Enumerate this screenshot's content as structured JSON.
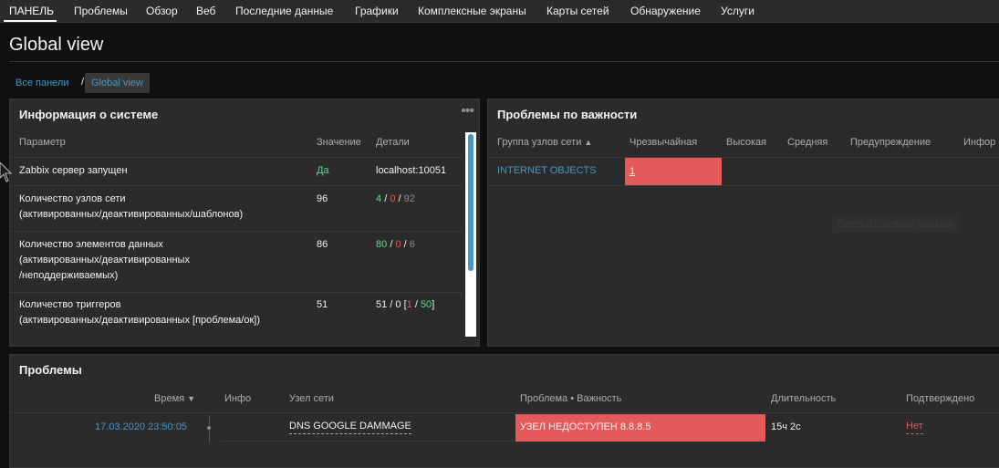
{
  "nav": {
    "items": [
      "ПАНЕЛЬ",
      "Проблемы",
      "Обзор",
      "Веб",
      "Последние данные",
      "Графики",
      "Комплексные экраны",
      "Карты сетей",
      "Обнаружение",
      "Услуги"
    ]
  },
  "page": {
    "title": "Global view"
  },
  "breadcrumb": {
    "all": "Все панели",
    "sep": "/",
    "current": "Global view"
  },
  "sysinfo": {
    "title": "Информация о системе",
    "headers": {
      "param": "Параметр",
      "value": "Значение",
      "details": "Детали"
    },
    "rows": [
      {
        "param": [
          "Zabbix сервер запущен"
        ],
        "value": "Да",
        "details": "localhost:10051"
      },
      {
        "param": [
          "Количество узлов сети",
          "(активированных/деактивированных/шаблонов)"
        ],
        "value": "96",
        "d1": "4",
        "d2": "0",
        "d3": "92",
        "sep": "/"
      },
      {
        "param": [
          "Количество элементов данных",
          "(активированных/деактивированных",
          "/неподдерживаемых)"
        ],
        "value": "86",
        "d1": "80",
        "d2": "0",
        "d3": "6",
        "sep": "/"
      },
      {
        "param": [
          "Количество триггеров",
          "(активированных/деактивированных [проблема/ок])"
        ],
        "value": "51",
        "prefix": "51 / 0 [",
        "d1": "1",
        "mid": " / ",
        "d2": "50",
        "suffix": "]"
      }
    ]
  },
  "severity": {
    "title": "Проблемы по важности",
    "headers": [
      "Группа узлов сети",
      "Чрезвычайная",
      "Высокая",
      "Средняя",
      "Предупреждение",
      "Инфор"
    ],
    "rows": [
      {
        "group": "INTERNET OBJECTS",
        "disaster": "1"
      }
    ],
    "ghost_button": "Сделать новый снимок"
  },
  "problems": {
    "title": "Проблемы",
    "headers": {
      "time": "Время",
      "info": "Инфо",
      "host": "Узел сети",
      "problem": "Проблема • Важность",
      "duration": "Длительность",
      "ack": "Подтверждено"
    },
    "rows": [
      {
        "time": "17.03.2020 23:50:05",
        "host": "DNS GOOGLE DAMMAGE",
        "problem": "УЗЕЛ НЕДОСТУПЕН 8.8.8.5",
        "duration": "15ч 2с",
        "ack": "Нет"
      }
    ]
  },
  "colors": {
    "disaster": "#e45959",
    "link": "#4796c4",
    "ok_green": "#59db8f",
    "panel_bg": "#2b2b2b",
    "page_bg": "#0e1012"
  },
  "icons": {
    "sort_asc": "▲",
    "sort_desc": "▼",
    "menu": "•••"
  }
}
